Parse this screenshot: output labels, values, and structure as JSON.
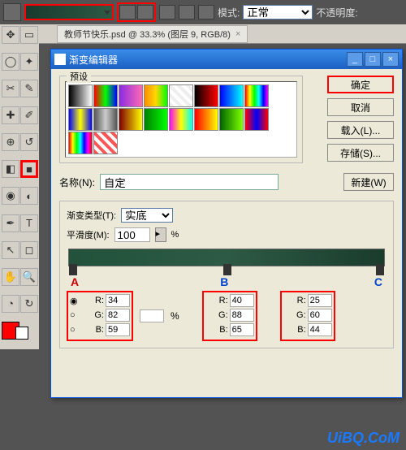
{
  "topbar": {
    "mode_label": "模式:",
    "mode_value": "正常",
    "opacity_label": "不透明度:"
  },
  "doc_tab": {
    "title": "教师节快乐.psd @ 33.3% (图层 9, RGB/8)"
  },
  "dialog": {
    "title": "渐变编辑器",
    "presets_label": "预设",
    "ok": "确定",
    "cancel": "取消",
    "load": "载入(L)...",
    "save": "存储(S)...",
    "name_label": "名称(N):",
    "name_value": "自定",
    "new_btn": "新建(W)",
    "type_label": "渐变类型(T):",
    "type_value": "实底",
    "smooth_label": "平滑度(M):",
    "smooth_value": "100",
    "smooth_unit": "%"
  },
  "letters": {
    "a": "A",
    "b": "B",
    "c": "C"
  },
  "rgb_a": {
    "r": "34",
    "g": "82",
    "b": "59"
  },
  "rgb_b": {
    "r": "40",
    "g": "88",
    "b": "65"
  },
  "rgb_c": {
    "r": "25",
    "g": "60",
    "b": "44"
  },
  "rgb_labels": {
    "r": "R:",
    "g": "G:",
    "b": "B:"
  },
  "pct": "%",
  "watermark": "UiBQ.CoM",
  "swatches": [
    "linear-gradient(to right,#000,#fff)",
    "linear-gradient(to right,#ff0000,#00ff00,#0000ff)",
    "linear-gradient(to right,#8a2be2,#ff69b4)",
    "linear-gradient(to right,#ff8c00,#ffd700,#00ff00)",
    "repeating-linear-gradient(45deg,#eee,#eee 4px,#fff 4px,#fff 8px)",
    "linear-gradient(to right,#000,#ff0000)",
    "linear-gradient(to right,#00f,#0ff)",
    "linear-gradient(to right,#f00,#ff0,#0f0,#0ff,#00f,#f0f)",
    "linear-gradient(to right,#00f,#ff0,#00f)",
    "linear-gradient(to right,#555,#ccc,#555)",
    "linear-gradient(to right,#800000,#ff0)",
    "linear-gradient(to right,#008000,#0f0)",
    "linear-gradient(to right,#f0f,#ff0,#0ff)",
    "linear-gradient(to right,#f00,#ff0)",
    "linear-gradient(to right,#006400,#7fff00)",
    "linear-gradient(to right,#f00,#00f,#f00)",
    "linear-gradient(to right,#f00,#ff0,#0f0,#0ff,#00f,#f0f,#f00)",
    "repeating-linear-gradient(45deg,#f55,#f55 4px,#fff 4px,#fff 8px)"
  ]
}
